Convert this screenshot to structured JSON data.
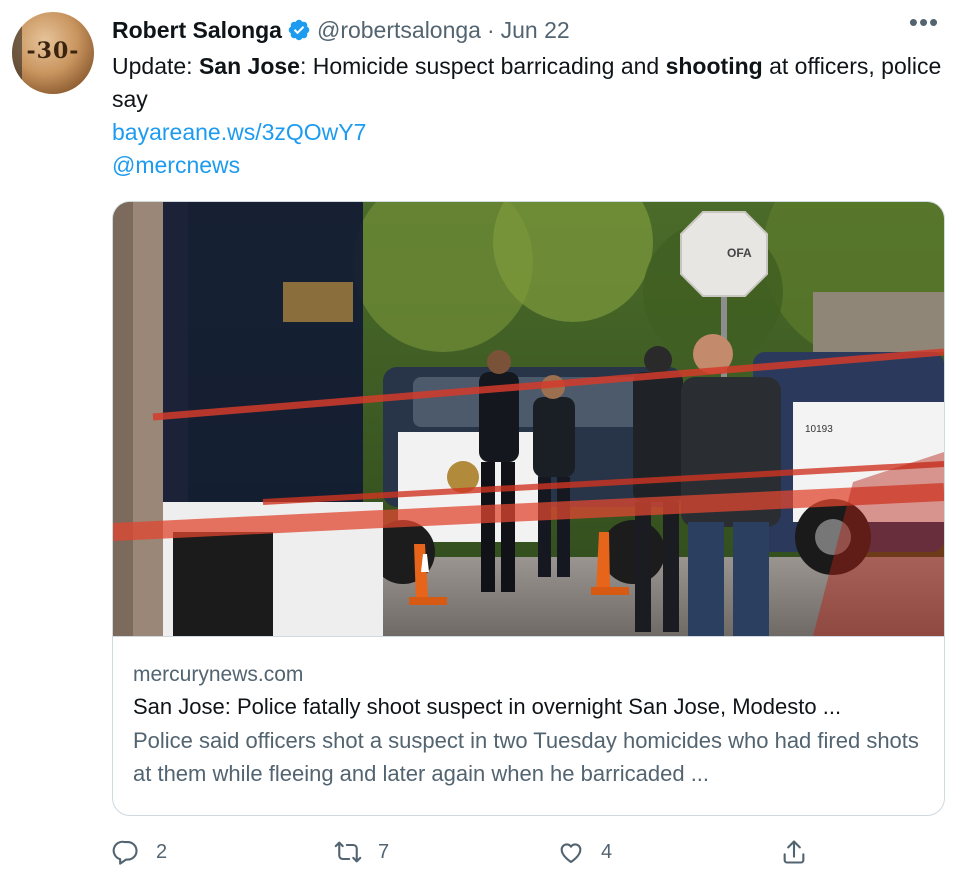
{
  "author": {
    "name": "Robert Salonga",
    "handle": "@robertsalonga",
    "separator": "·",
    "date": "Jun 22",
    "avatar_text": "-30-"
  },
  "more_label": "•••",
  "tweet": {
    "seg1": "Update: ",
    "seg2": "San Jose",
    "seg3": ": Homicide suspect barricading and ",
    "seg4": "shooting",
    "seg5": " at officers, police say",
    "link": "bayareane.ws/3zQOwY7",
    "mention": "@mercnews"
  },
  "card": {
    "domain": "mercurynews.com",
    "title": "San Jose: Police fatally shoot suspect in overnight San Jose, Modesto ...",
    "description": "Police said officers shot a suspect in two Tuesday homicides who had fired shots at them while fleeing and later again when he barricaded ...",
    "image_texts": {
      "stop_sign": "OFA",
      "truck_number": "10193"
    }
  },
  "actions": {
    "replies": "2",
    "retweets": "7",
    "likes": "4"
  },
  "colors": {
    "accent": "#1d9bf0",
    "secondary_text": "#536471",
    "border": "#cfd9de"
  }
}
